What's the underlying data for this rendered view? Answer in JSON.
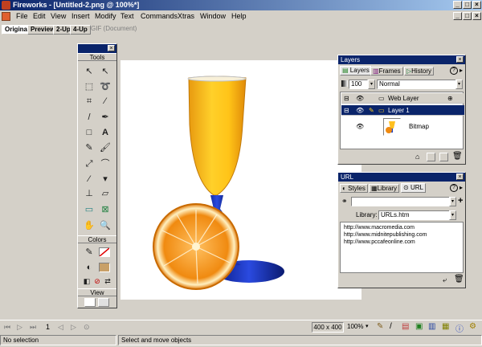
{
  "window": {
    "title": "Fireworks - [Untitled-2.png @ 100%*]"
  },
  "menu": [
    "File",
    "Edit",
    "View",
    "Insert",
    "Modify",
    "Text",
    "Commands",
    "Xtras",
    "Window",
    "Help"
  ],
  "doc_tabs": [
    {
      "label": "Original",
      "active": true
    },
    {
      "label": "Preview",
      "active": false
    },
    {
      "label": "2-Up",
      "active": false
    },
    {
      "label": "4-Up",
      "active": false
    },
    {
      "label": "GIF (Document)",
      "active": false,
      "disabled": true
    }
  ],
  "tools_panel": {
    "section_tools": "Tools",
    "section_colors": "Colors",
    "section_view": "View"
  },
  "layers_panel": {
    "title": "Layers",
    "tabs": [
      "Layers",
      "Frames",
      "History"
    ],
    "opacity": "100",
    "blend_mode": "Normal",
    "rows": [
      {
        "name": "Web Layer"
      },
      {
        "name": "Layer 1"
      },
      {
        "name": "Bitmap"
      }
    ]
  },
  "url_panel": {
    "title": "URL",
    "tabs": [
      "Styles",
      "Library",
      "URL"
    ],
    "url_input": "",
    "library_label": "Library:",
    "library_value": "URLs.htm",
    "urls": [
      "http://www.macromedia.com",
      "http://www.midnitepublishing.com",
      "http://www.pccafeonline.com"
    ]
  },
  "statusbar": {
    "frame": "1",
    "canvas_size": "400 x 400",
    "zoom": "100%",
    "selection": "No selection",
    "hint": "Select and move objects"
  },
  "colors": {
    "accent": "#0a246a",
    "fill": "#c8a068",
    "canvas": "#ffffff"
  }
}
